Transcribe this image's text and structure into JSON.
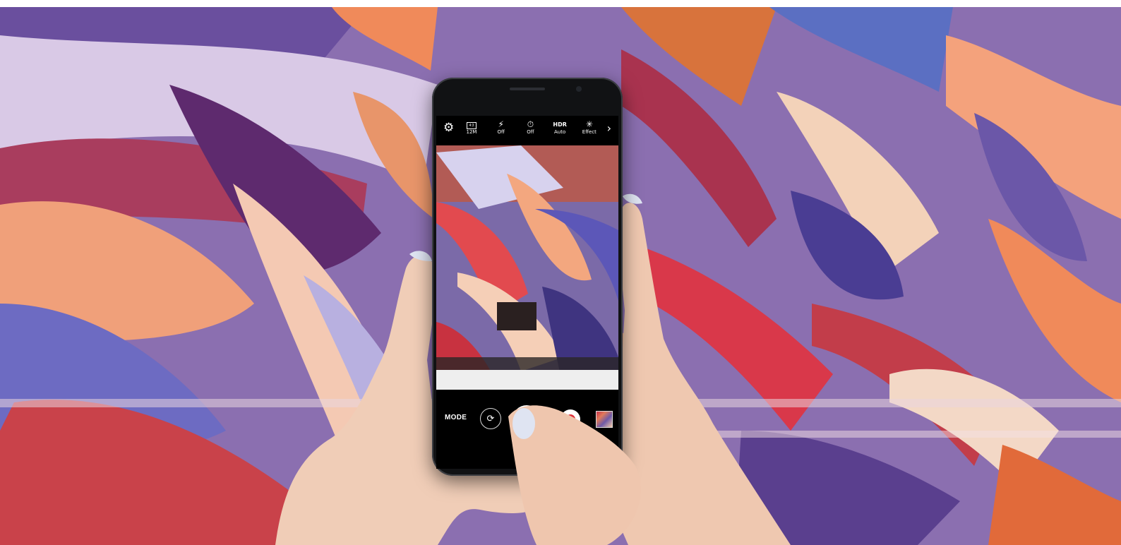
{
  "camera_app": {
    "top_bar": {
      "settings_icon": "gear-icon",
      "items": [
        {
          "icon": "resolution-icon",
          "label": "12M"
        },
        {
          "icon": "flash-off-icon",
          "label": "Off"
        },
        {
          "icon": "timer-icon",
          "label": "Off"
        },
        {
          "icon": "hdr-icon",
          "icon_text": "HDR",
          "label": "Auto"
        },
        {
          "icon": "effect-icon",
          "label": "Effect"
        }
      ],
      "more_icon": "chevron-right-icon"
    },
    "bottom_bar": {
      "mode_label": "MODE",
      "switch_camera_icon": "camera-switch-icon",
      "shutter_icon": "shutter-icon",
      "record_icon": "record-icon",
      "gallery_icon": "gallery-thumbnail"
    }
  },
  "colors": {
    "mural_purple": "#7d5aa6",
    "mural_red": "#d23a3a",
    "mural_orange": "#f08a5a",
    "mural_peach": "#f5c3a3",
    "skin": "#f0cdb7",
    "nail": "#dfe4f2",
    "phone_body": "#111214",
    "record_red": "#e0303a"
  }
}
